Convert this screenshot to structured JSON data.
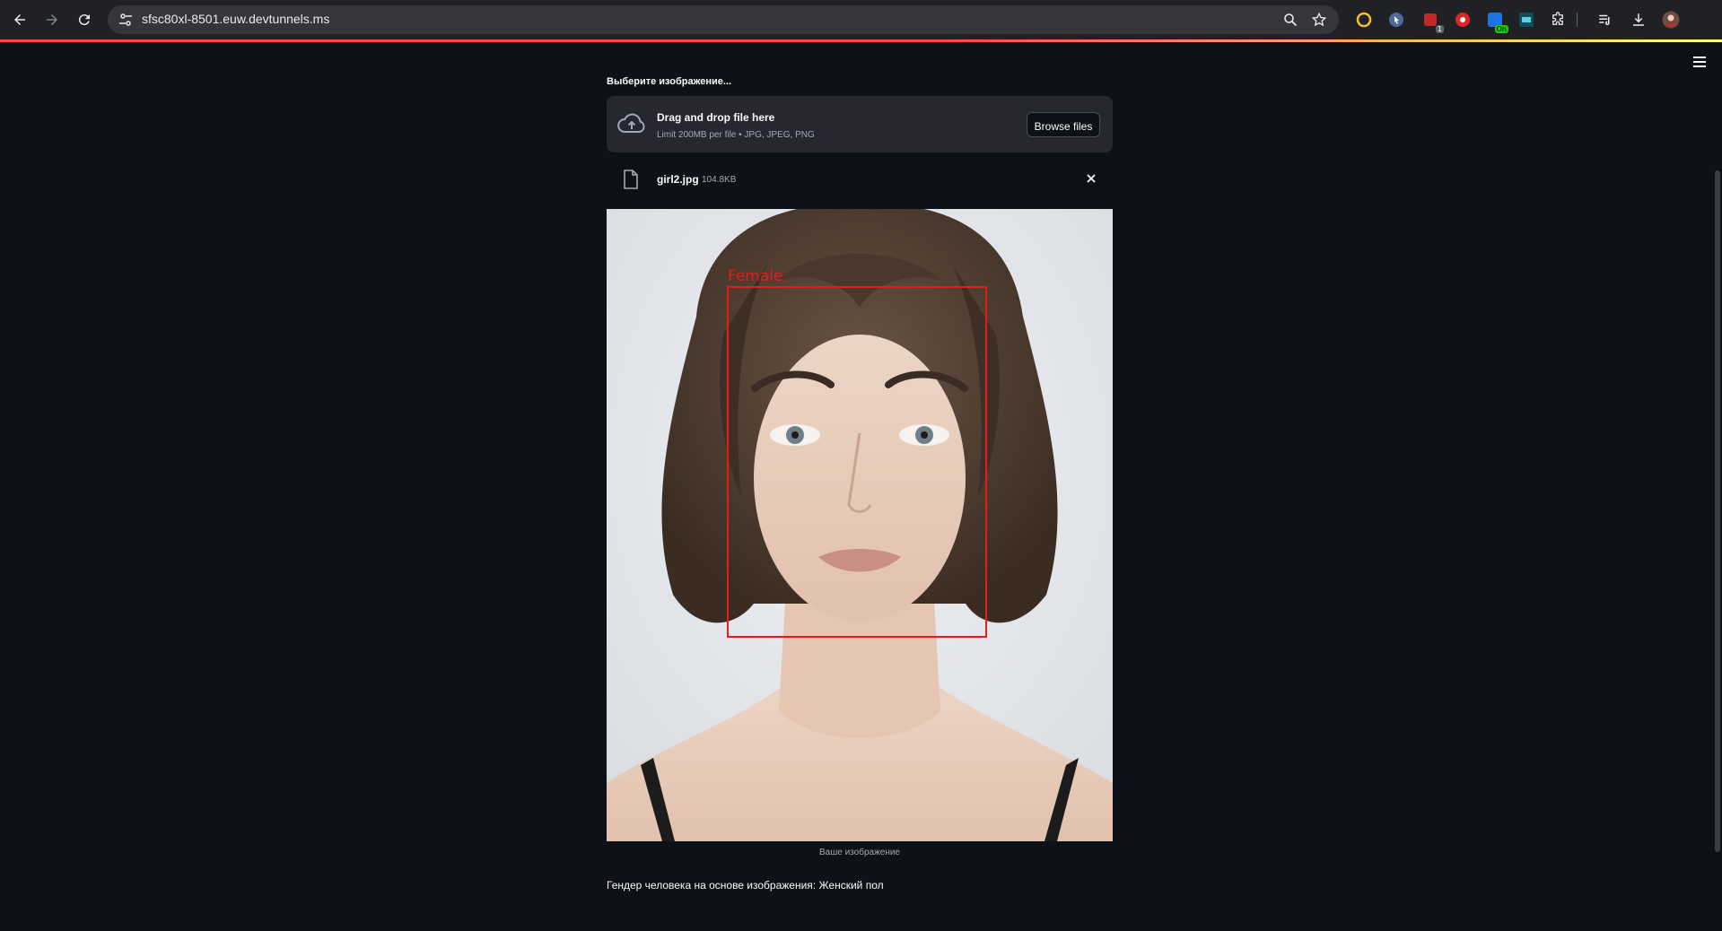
{
  "browser": {
    "url": "sfsc80xl-8501.euw.devtunnels.ms",
    "extension_badge": "1",
    "extension_on_label": "On"
  },
  "uploader": {
    "label": "Выберите изображение...",
    "drop_title": "Drag and drop file here",
    "limit_text": "Limit 200MB per file • JPG, JPEG, PNG",
    "browse_label": "Browse files"
  },
  "file": {
    "name": "girl2.jpg",
    "size": "104.8KB"
  },
  "image": {
    "detection_label": "Female",
    "caption": "Ваше изображение"
  },
  "result": {
    "text": "Гендер человека на основе изображения: Женский пол"
  },
  "colors": {
    "background": "#0e1117",
    "panel": "#262730",
    "detection_box": "#e11d1d",
    "accent": "#ff4b4b"
  }
}
